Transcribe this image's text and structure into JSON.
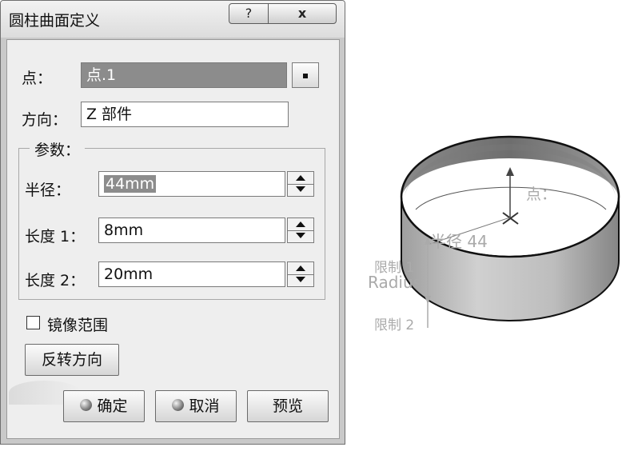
{
  "dialog": {
    "title": "圆柱曲面定义",
    "help_label": "?",
    "close_label": "x",
    "point_label": "点：",
    "point_value": "点.1",
    "direction_label": "方向：",
    "direction_value": "Z 部件",
    "params_group_title": "参数：",
    "radius_label": "半径：",
    "radius_value": "44mm",
    "length1_label": "长度 1：",
    "length1_value": "8mm",
    "length2_label": "长度 2：",
    "length2_value": "20mm",
    "mirror_label": "镜像范围",
    "mirror_checked": false,
    "reverse_label": "反转方向",
    "ok_label": "确定",
    "cancel_label": "取消",
    "preview_label": "预览"
  },
  "viewer": {
    "point_annotation": "点：",
    "radius_annotation": "半径 44",
    "limit1_annotation": "限制 1",
    "radius_en_annotation": "Radius",
    "limit2_annotation": "限制 2"
  }
}
